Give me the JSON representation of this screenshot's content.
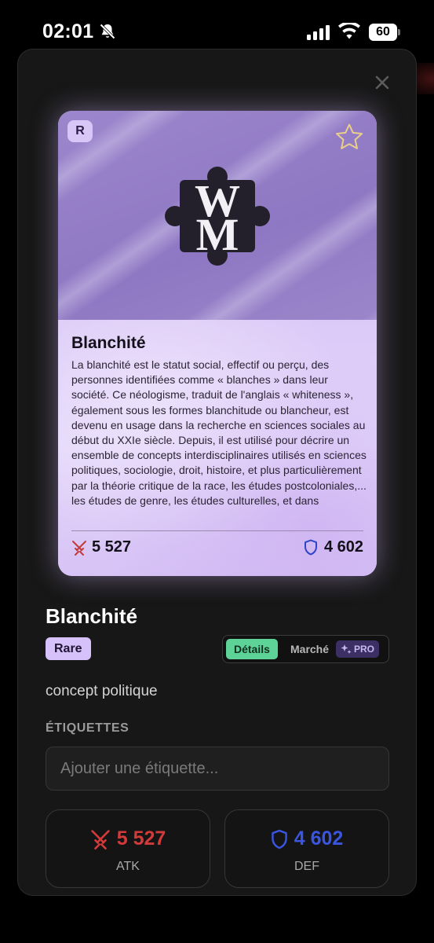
{
  "status_bar": {
    "time": "02:01",
    "battery": "60"
  },
  "modal": {
    "close_icon": "close-icon",
    "card": {
      "rarity_letter": "R",
      "title": "Blanchité",
      "description": "La blanchité est le statut social, effectif ou perçu, des personnes identifiées comme « blanches » dans leur société. Ce néologisme, traduit de l'anglais « whiteness », également sous les formes blanchitude ou blancheur, est devenu en usage dans la recherche en sciences sociales au début du XXIe siècle. Depuis, il est utilisé pour décrire un ensemble de concepts interdisciplinaires utilisés en sciences politiques, sociologie, droit, histoire, et plus particulièrement par la théorie critique de la race, les études postcoloniales,... les études de genre, les études culturelles, et dans",
      "atk": "5 527",
      "def": "4 602",
      "colors": {
        "art": "#9c86cc",
        "body": "#e4d6fa"
      }
    },
    "title": "Blanchité",
    "rarity": "Rare",
    "tabs": {
      "details": "Détails",
      "market": "Marché",
      "pro": "PRO"
    },
    "category": "concept politique",
    "tags_heading": "ÉTIQUETTES",
    "tag_placeholder": "Ajouter une étiquette...",
    "stats": {
      "atk_value": "5 527",
      "atk_label": "ATK",
      "def_value": "4 602",
      "def_label": "DEF"
    },
    "colors": {
      "accent_green": "#5ed398",
      "atk_red": "#d33a3a",
      "def_blue": "#3a55e0",
      "rarity_purple": "#d7c1fb"
    }
  }
}
